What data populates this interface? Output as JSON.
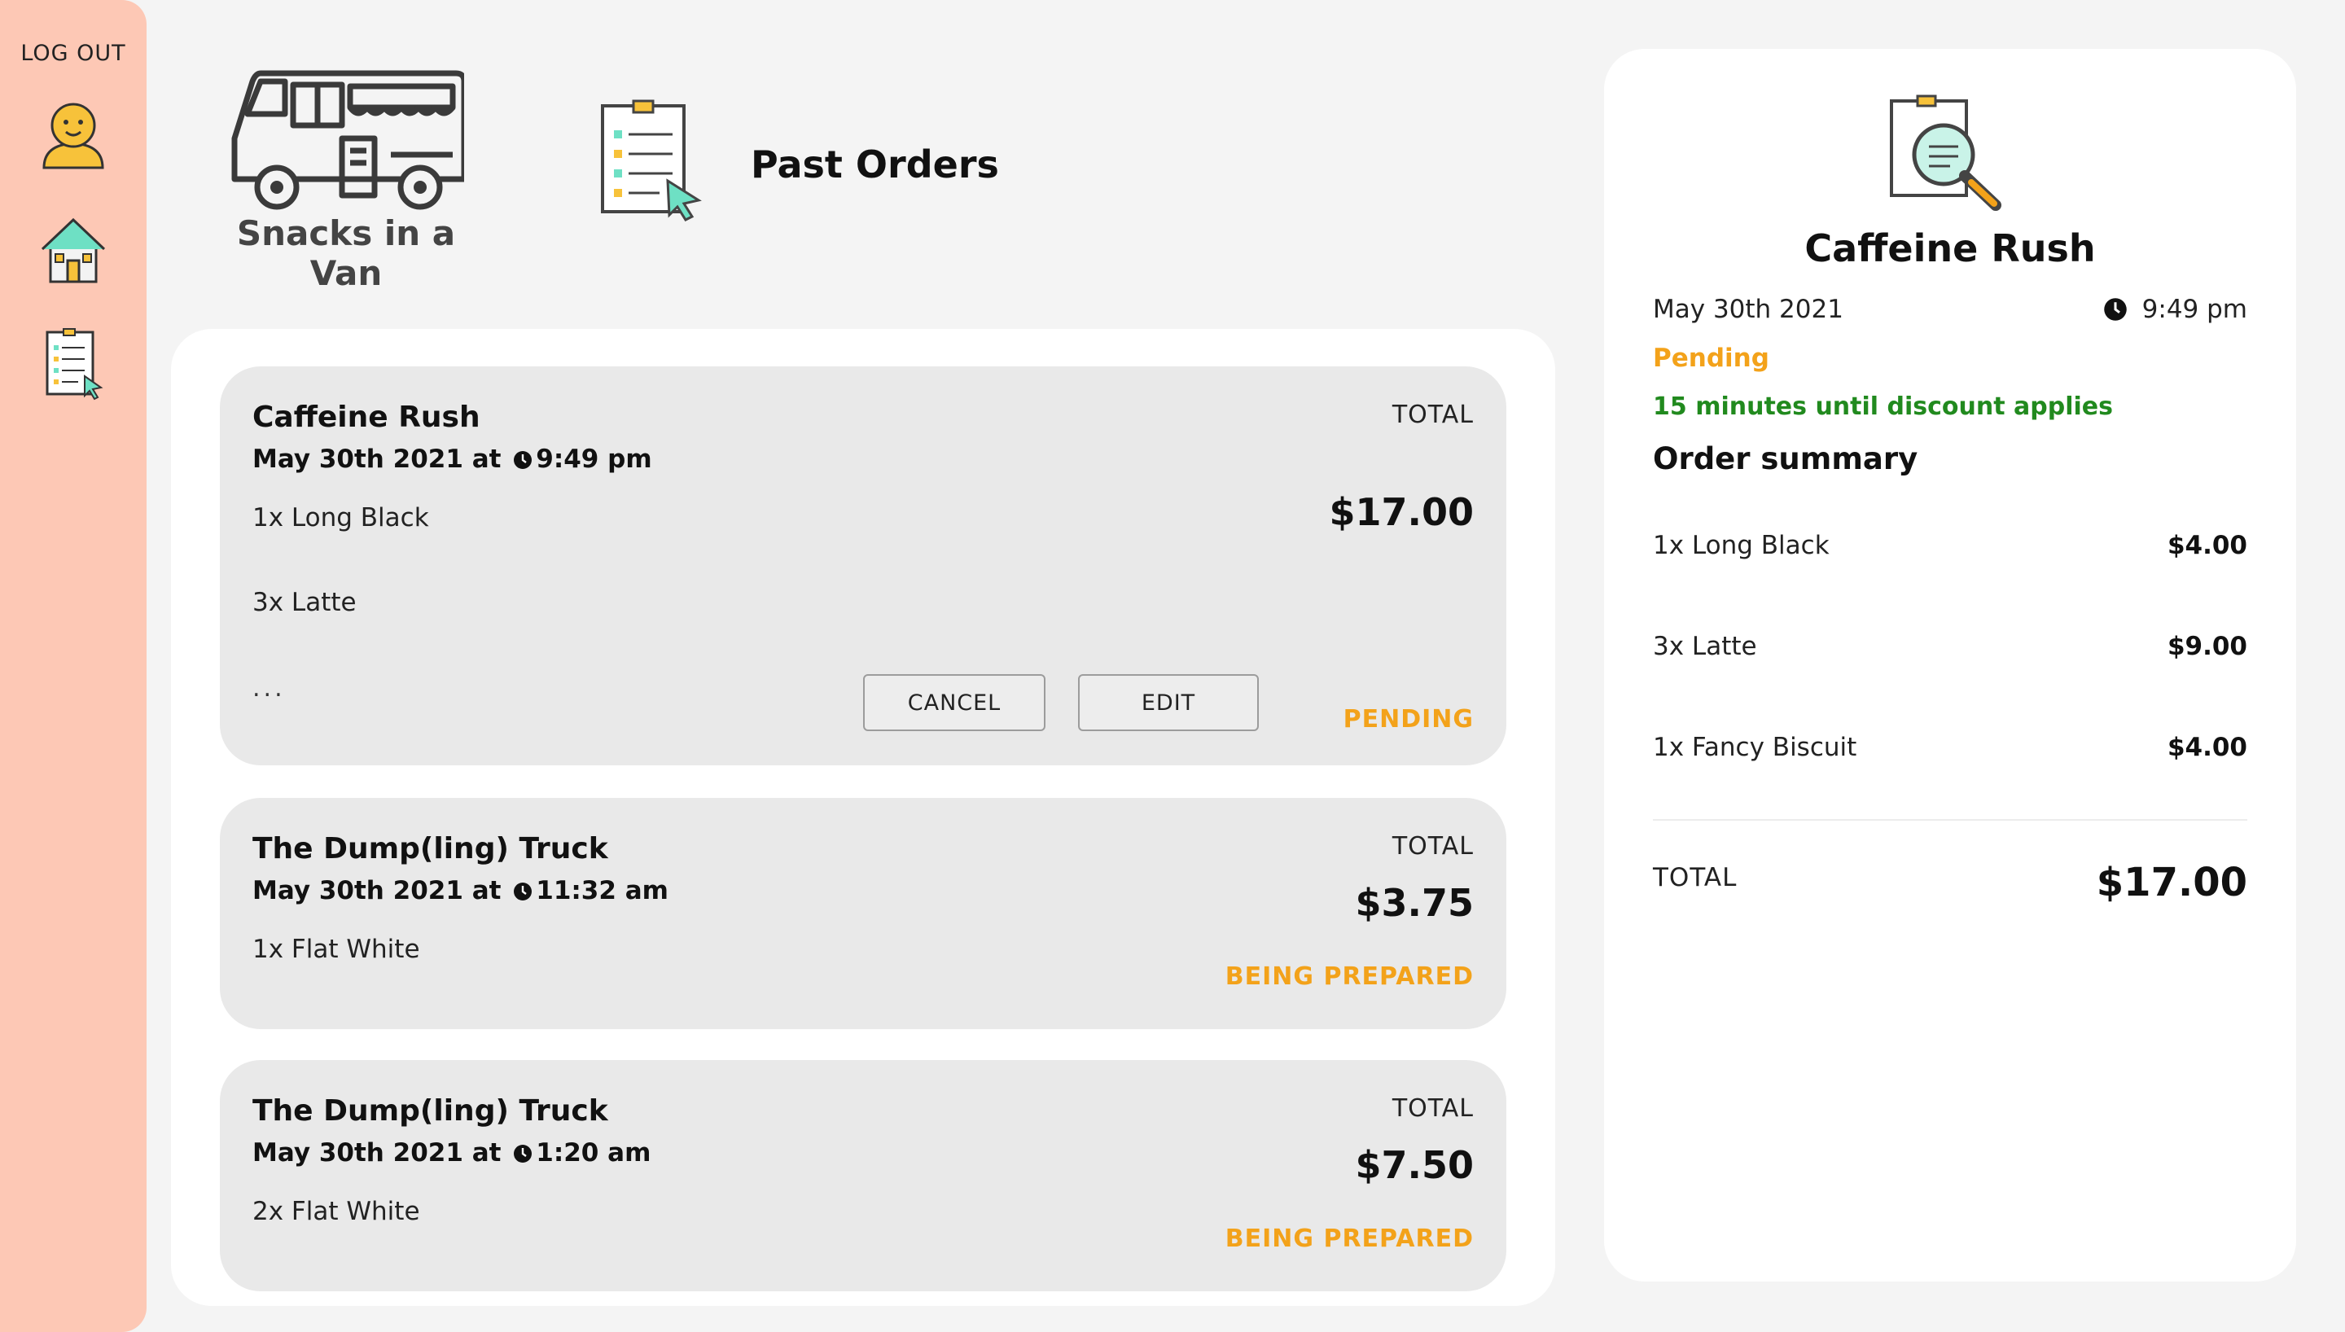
{
  "sidebar": {
    "logout_label": "LOG OUT"
  },
  "brand": {
    "name": "Snacks in a Van"
  },
  "page": {
    "title": "Past Orders"
  },
  "colors": {
    "sidebar_bg": "#fdc8b5",
    "status_orange": "#f3a21a",
    "discount_green": "#218a1e",
    "card_bg": "#e9e9e9"
  },
  "orders": [
    {
      "vendor": "Caffeine Rush",
      "date_prefix": "May 30th 2021 at",
      "time": "9:49 pm",
      "items": [
        "1x Long Black",
        "3x Latte"
      ],
      "more": "...",
      "total_label": "TOTAL",
      "total": "$17.00",
      "status": "PENDING",
      "cancel_label": "CANCEL",
      "edit_label": "EDIT"
    },
    {
      "vendor": "The Dump(ling) Truck",
      "date_prefix": "May 30th 2021 at",
      "time": "11:32 am",
      "items": [
        "1x Flat White"
      ],
      "total_label": "TOTAL",
      "total": "$3.75",
      "status": "BEING PREPARED"
    },
    {
      "vendor": "The Dump(ling) Truck",
      "date_prefix": "May 30th 2021 at",
      "time": "1:20 am",
      "items": [
        "2x Flat White"
      ],
      "total_label": "TOTAL",
      "total": "$7.50",
      "status": "BEING PREPARED"
    }
  ],
  "detail": {
    "vendor": "Caffeine Rush",
    "date": "May 30th 2021",
    "time": "9:49 pm",
    "status": "Pending",
    "discount_note": "15 minutes until discount applies",
    "summary_title": "Order summary",
    "items": [
      {
        "name": "1x Long Black",
        "price": "$4.00"
      },
      {
        "name": "3x Latte",
        "price": "$9.00"
      },
      {
        "name": "1x Fancy Biscuit",
        "price": "$4.00"
      }
    ],
    "total_label": "TOTAL",
    "total": "$17.00"
  }
}
